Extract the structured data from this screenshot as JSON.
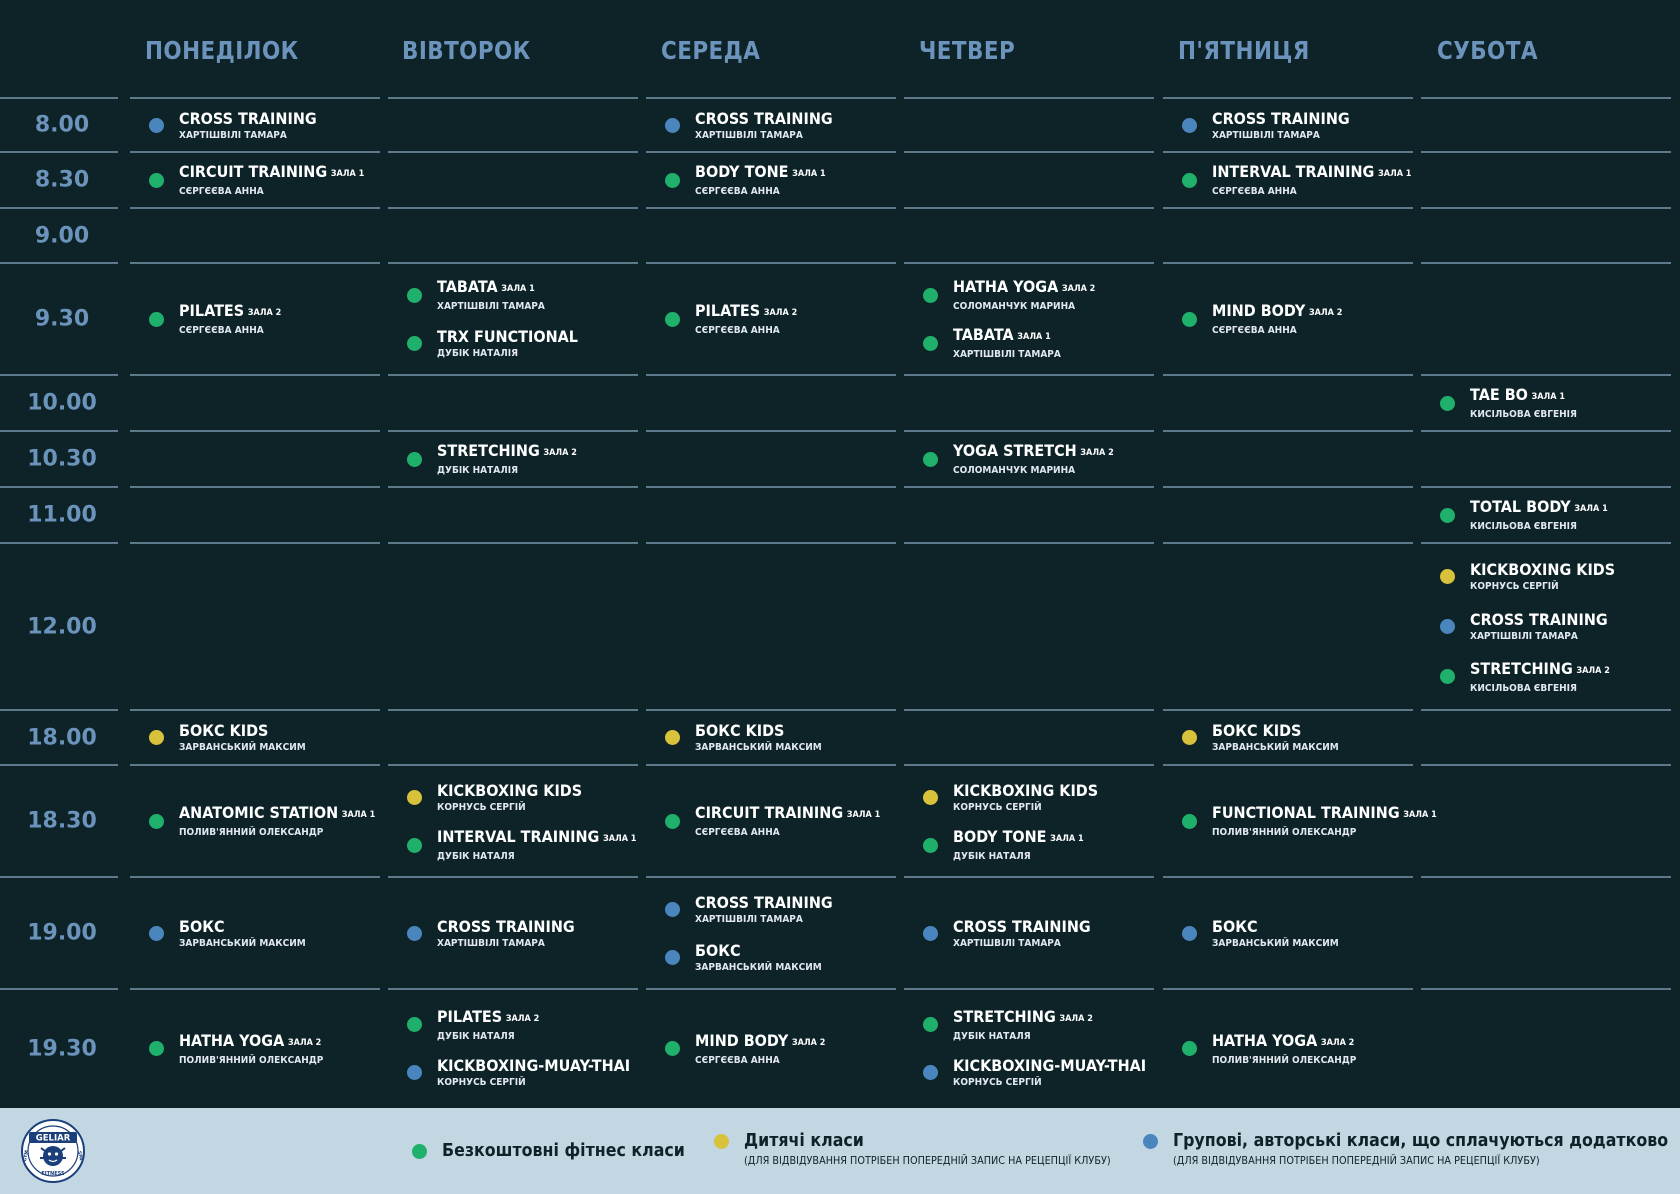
{
  "days": [
    "ПОНЕДІЛОК",
    "ВІВТОРОК",
    "СЕРЕДА",
    "ЧЕТВЕР",
    "П'ЯТНИЦЯ",
    "СУБОТА"
  ],
  "times": [
    "8.00",
    "8.30",
    "9.00",
    "9.30",
    "10.00",
    "10.30",
    "11.00",
    "12.00",
    "18.00",
    "18.30",
    "19.00",
    "19.30"
  ],
  "classes": [
    {
      "day": 0,
      "slot": 0,
      "color": "blue",
      "title": "CROSS TRAINING",
      "coach": "ХАРТІШВІЛІ ТАМАРА"
    },
    {
      "day": 2,
      "slot": 0,
      "color": "blue",
      "title": "CROSS TRAINING",
      "coach": "ХАРТІШВІЛІ ТАМАРА"
    },
    {
      "day": 4,
      "slot": 0,
      "color": "blue",
      "title": "CROSS TRAINING",
      "coach": "ХАРТІШВІЛІ ТАМАРА"
    },
    {
      "day": 0,
      "slot": 1,
      "color": "green",
      "title": "CIRCUIT TRAINING",
      "hall": "ЗАЛА 1",
      "coach": "СЄРГЄЄВА АННА"
    },
    {
      "day": 2,
      "slot": 1,
      "color": "green",
      "title": "BODY TONE",
      "hall": "ЗАЛА 1",
      "coach": "СЄРГЄЄВА АННА"
    },
    {
      "day": 4,
      "slot": 1,
      "color": "green",
      "title": "INTERVAL TRAINING",
      "hall": "ЗАЛА 1",
      "coach": "СЄРГЄЄВА АННА"
    },
    {
      "day": 0,
      "slot": 3,
      "color": "green",
      "title": "PILATES",
      "hall": "ЗАЛА 2",
      "coach": "СЄРГЄЄВА АННА"
    },
    {
      "day": 1,
      "slot": 3,
      "color": "green",
      "title": "TABATA",
      "hall": "ЗАЛА 1",
      "coach": "ХАРТІШВІЛІ ТАМАРА"
    },
    {
      "day": 1,
      "slot": 3,
      "color": "green",
      "title": "TRX FUNCTIONAL",
      "coach": "ДУБІК НАТАЛІЯ"
    },
    {
      "day": 2,
      "slot": 3,
      "color": "green",
      "title": "PILATES",
      "hall": "ЗАЛА 2",
      "coach": "СЄРГЄЄВА АННА"
    },
    {
      "day": 3,
      "slot": 3,
      "color": "green",
      "title": "HATHA YOGA",
      "hall": "ЗАЛА 2",
      "coach": "СОЛОМАНЧУК МАРИНА"
    },
    {
      "day": 3,
      "slot": 3,
      "color": "green",
      "title": "TABATA",
      "hall": "ЗАЛА 1",
      "coach": "ХАРТІШВІЛІ ТАМАРА"
    },
    {
      "day": 4,
      "slot": 3,
      "color": "green",
      "title": "MIND BODY",
      "hall": "ЗАЛА 2",
      "coach": "СЄРГЄЄВА АННА"
    },
    {
      "day": 5,
      "slot": 4,
      "color": "green",
      "title": "TAE BO",
      "hall": "ЗАЛА 1",
      "coach": "КИСІЛЬОВА ЄВГЕНІЯ"
    },
    {
      "day": 1,
      "slot": 5,
      "color": "green",
      "title": "STRETCHING",
      "hall": "ЗАЛА 2",
      "coach": "ДУБІК НАТАЛІЯ"
    },
    {
      "day": 3,
      "slot": 5,
      "color": "green",
      "title": "YOGA STRETCH",
      "hall": "ЗАЛА 2",
      "coach": "СОЛОМАНЧУК МАРИНА"
    },
    {
      "day": 5,
      "slot": 6,
      "color": "green",
      "title": "TOTAL BODY",
      "hall": "ЗАЛА 1",
      "coach": "КИСІЛЬОВА ЄВГЕНІЯ"
    },
    {
      "day": 5,
      "slot": 7,
      "color": "yellow",
      "title": "KICKBOXING KIDS",
      "coach": "КОРНУСЬ СЕРГІЙ"
    },
    {
      "day": 5,
      "slot": 7,
      "color": "blue",
      "title": "CROSS TRAINING",
      "coach": "ХАРТІШВІЛІ ТАМАРА"
    },
    {
      "day": 5,
      "slot": 7,
      "color": "green",
      "title": "STRETCHING",
      "hall": "ЗАЛА 2",
      "coach": "КИСІЛЬОВА ЄВГЕНІЯ"
    },
    {
      "day": 0,
      "slot": 8,
      "color": "yellow",
      "title": "БОКС KIDS",
      "coach": "ЗАРВАНСЬКИЙ МАКСИМ"
    },
    {
      "day": 2,
      "slot": 8,
      "color": "yellow",
      "title": "БОКС KIDS",
      "coach": "ЗАРВАНСЬКИЙ МАКСИМ"
    },
    {
      "day": 4,
      "slot": 8,
      "color": "yellow",
      "title": "БОКС KIDS",
      "coach": "ЗАРВАНСЬКИЙ МАКСИМ"
    },
    {
      "day": 0,
      "slot": 9,
      "color": "green",
      "title": "ANATOMIC STATION",
      "hall": "ЗАЛА 1",
      "coach": "ПОЛИВ'ЯННИЙ ОЛЕКСАНДР"
    },
    {
      "day": 1,
      "slot": 9,
      "color": "yellow",
      "title": "KICKBOXING KIDS",
      "coach": "КОРНУСЬ СЕРГІЙ"
    },
    {
      "day": 1,
      "slot": 9,
      "color": "green",
      "title": "INTERVAL TRAINING",
      "hall": "ЗАЛА 1",
      "coach": "ДУБІК НАТАЛЯ"
    },
    {
      "day": 2,
      "slot": 9,
      "color": "green",
      "title": "CIRCUIT TRAINING",
      "hall": "ЗАЛА 1",
      "coach": "СЄРГЄЄВА АННА"
    },
    {
      "day": 3,
      "slot": 9,
      "color": "yellow",
      "title": "KICKBOXING KIDS",
      "coach": "КОРНУСЬ СЕРГІЙ"
    },
    {
      "day": 3,
      "slot": 9,
      "color": "green",
      "title": "BODY TONE",
      "hall": "ЗАЛА 1",
      "coach": "ДУБІК НАТАЛЯ"
    },
    {
      "day": 4,
      "slot": 9,
      "color": "green",
      "title": "FUNCTIONAL TRAINING",
      "hall": "ЗАЛА 1",
      "coach": "ПОЛИВ'ЯННИЙ ОЛЕКСАНДР"
    },
    {
      "day": 0,
      "slot": 10,
      "color": "blue",
      "title": "БОКС",
      "coach": "ЗАРВАНСЬКИЙ МАКСИМ"
    },
    {
      "day": 1,
      "slot": 10,
      "color": "blue",
      "title": "CROSS TRAINING",
      "coach": "ХАРТІШВІЛІ ТАМАРА"
    },
    {
      "day": 2,
      "slot": 10,
      "color": "blue",
      "title": "CROSS TRAINING",
      "coach": "ХАРТІШВІЛІ ТАМАРА"
    },
    {
      "day": 2,
      "slot": 10,
      "color": "blue",
      "title": "БОКС",
      "coach": "ЗАРВАНСЬКИЙ МАКСИМ"
    },
    {
      "day": 3,
      "slot": 10,
      "color": "blue",
      "title": "CROSS TRAINING",
      "coach": "ХАРТІШВІЛІ ТАМАРА"
    },
    {
      "day": 4,
      "slot": 10,
      "color": "blue",
      "title": "БОКС",
      "coach": "ЗАРВАНСЬКИЙ МАКСИМ"
    },
    {
      "day": 0,
      "slot": 11,
      "color": "green",
      "title": "HATHA YOGA",
      "hall": "ЗАЛА 2",
      "coach": "ПОЛИВ'ЯННИЙ ОЛЕКСАНДР"
    },
    {
      "day": 1,
      "slot": 11,
      "color": "green",
      "title": "PILATES",
      "hall": "ЗАЛА 2",
      "coach": "ДУБІК НАТАЛЯ"
    },
    {
      "day": 1,
      "slot": 11,
      "color": "blue",
      "title": "KICKBOXING-MUAY-THAI",
      "coach": "КОРНУСЬ СЕРГІЙ"
    },
    {
      "day": 2,
      "slot": 11,
      "color": "green",
      "title": "MIND BODY",
      "hall": "ЗАЛА 2",
      "coach": "СЄРГЄЄВА АННА"
    },
    {
      "day": 3,
      "slot": 11,
      "color": "green",
      "title": "STRETCHING",
      "hall": "ЗАЛА 2",
      "coach": "ДУБІК НАТАЛЯ"
    },
    {
      "day": 3,
      "slot": 11,
      "color": "blue",
      "title": "KICKBOXING-MUAY-THAI",
      "coach": "КОРНУСЬ СЕРГІЙ"
    },
    {
      "day": 4,
      "slot": 11,
      "color": "green",
      "title": "HATHA YOGA",
      "hall": "ЗАЛА 2",
      "coach": "ПОЛИВ'ЯННИЙ ОЛЕКСАНДР"
    }
  ],
  "colors": {
    "background": "#0d2328",
    "header": "#6b93bb",
    "line": "#5d7a8b",
    "green": "#1fb06b",
    "yellow": "#d8c13b",
    "blue": "#4a86bd",
    "footer": "#c3d7e3"
  },
  "footer": {
    "logo": {
      "name": "GELIAR",
      "sub": "FITNESS",
      "side_left": "GYM",
      "side_right": "SPA",
      "icon": "lion-head-logo"
    },
    "legend": [
      {
        "color": "green",
        "label": "Безкоштовні фітнес класи",
        "note": ""
      },
      {
        "color": "yellow",
        "label": "Дитячі класи",
        "note": "(ДЛЯ ВІДВІДУВАННЯ ПОТРІБЕН ПОПЕРЕДНІЙ ЗАПИС НА РЕЦЕПЦІЇ КЛУБУ)"
      },
      {
        "color": "blue",
        "label": "Групові, авторські класи, що сплачуються додатково",
        "note": "(ДЛЯ ВІДВІДУВАННЯ ПОТРІБЕН ПОПЕРЕДНІЙ ЗАПИС НА РЕЦЕПЦІЇ КЛУБУ)"
      }
    ]
  }
}
